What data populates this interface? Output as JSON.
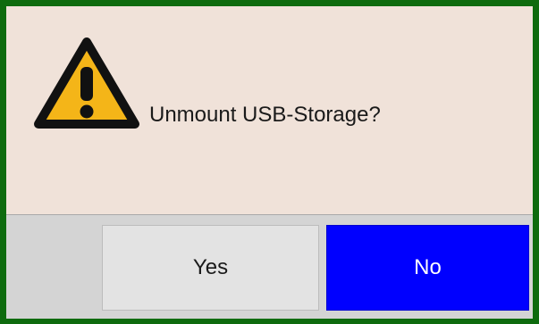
{
  "dialog": {
    "message": "Unmount USB-Storage?",
    "icon": "warning-icon",
    "border_color": "#0e6b0e",
    "background_color": "#f0e2d9"
  },
  "buttons": {
    "yes_label": "Yes",
    "no_label": "No",
    "focused": "No",
    "focus_color": "#0000ff"
  }
}
